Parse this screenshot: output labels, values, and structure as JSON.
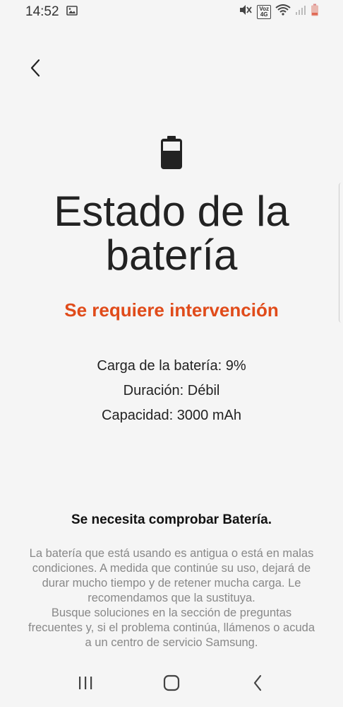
{
  "status_bar": {
    "time": "14:52",
    "volte_top": "Voz",
    "volte_bottom": "4G",
    "icons": [
      "image-icon",
      "mute-icon",
      "volte-icon",
      "wifi-icon",
      "signal-icon",
      "battery-low-icon"
    ]
  },
  "header": {
    "back_icon": "chevron-left-icon"
  },
  "main": {
    "icon": "battery-icon",
    "title_line1": "Estado de la",
    "title_line2": "batería",
    "status": "Se requiere intervención",
    "status_color": "#e04b1a",
    "info": [
      "Carga de la batería: 9%",
      "Duración: Débil",
      "Capacidad: 3000 mAh"
    ]
  },
  "notice": {
    "title": "Se necesita comprobar Batería.",
    "paragraph1": "La batería que está usando es antigua o está en malas condiciones. A medida que continúe su uso, dejará de durar mucho tiempo y de retener mucha carga. Le recomendamos que la sustituya.",
    "paragraph2": "Busque soluciones en la sección de preguntas frecuentes y, si el problema continúa, llámenos o acuda a un centro de servicio Samsung."
  },
  "navbar": {
    "icons": [
      "recents-icon",
      "home-icon",
      "back-icon"
    ]
  }
}
